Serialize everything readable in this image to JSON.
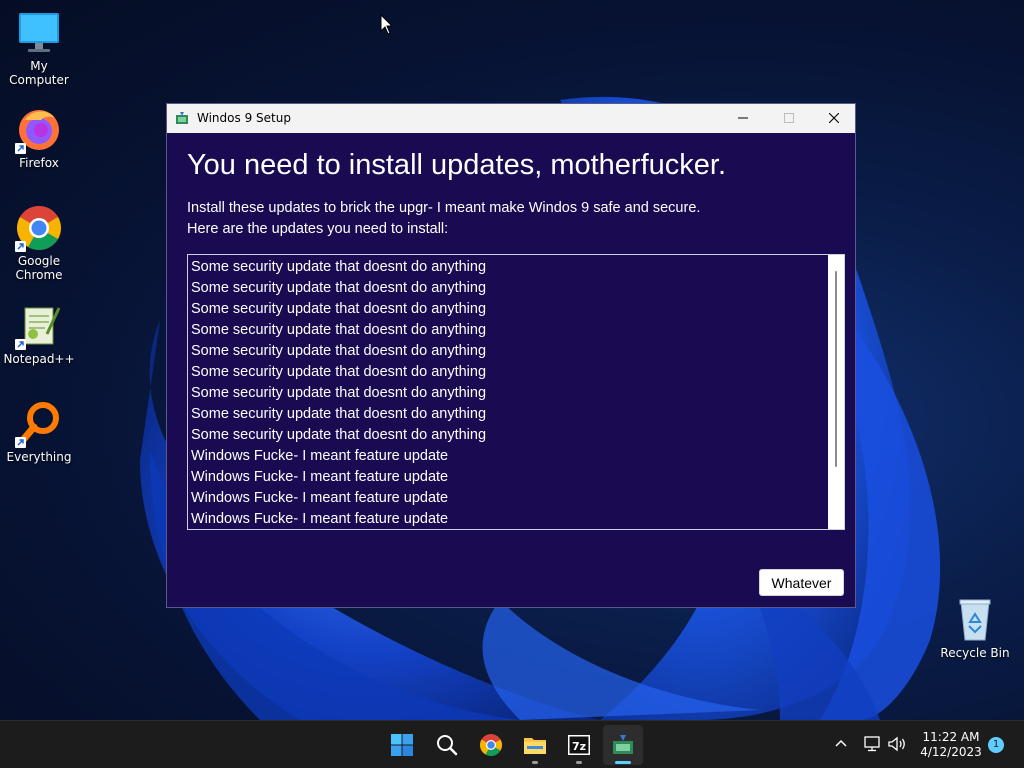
{
  "desktop_icons": [
    {
      "name": "my-computer",
      "label": "My Computer"
    },
    {
      "name": "firefox",
      "label": "Firefox"
    },
    {
      "name": "google-chrome",
      "label_line1": "Google",
      "label_line2": "Chrome"
    },
    {
      "name": "notepadpp",
      "label": "Notepad++"
    },
    {
      "name": "everything",
      "label": "Everything"
    },
    {
      "name": "recycle-bin",
      "label": "Recycle Bin"
    }
  ],
  "window": {
    "title": "Windos 9 Setup",
    "headline": "You need to install updates, motherfucker.",
    "description_line1": "Install these updates to brick the upgr- I meant make Windos 9 safe and secure.",
    "description_line2": "Here are the updates you need to install:",
    "updates": [
      "Some security update that doesnt do anything",
      "Some security update that doesnt do anything",
      "Some security update that doesnt do anything",
      "Some security update that doesnt do anything",
      "Some security update that doesnt do anything",
      "Some security update that doesnt do anything",
      "Some security update that doesnt do anything",
      "Some security update that doesnt do anything",
      "Some security update that doesnt do anything",
      "Windows Fucke- I meant feature update",
      "Windows Fucke- I meant feature update",
      "Windows Fucke- I meant feature update",
      "Windows Fucke- I meant feature update"
    ],
    "button_label": "Whatever",
    "colors": {
      "background": "#1a0a52",
      "titlebar": "#f3f3f3"
    }
  },
  "taskbar": {
    "apps": [
      "start-icon",
      "search-icon",
      "chrome-icon",
      "file-explorer-icon",
      "7zip-icon",
      "setup-app-icon"
    ],
    "tray": [
      "chevron-up-icon",
      "network-icon",
      "volume-icon"
    ],
    "time": "11:22 AM",
    "date": "4/12/2023",
    "notification_count": "1",
    "accent": "#60cdff"
  }
}
